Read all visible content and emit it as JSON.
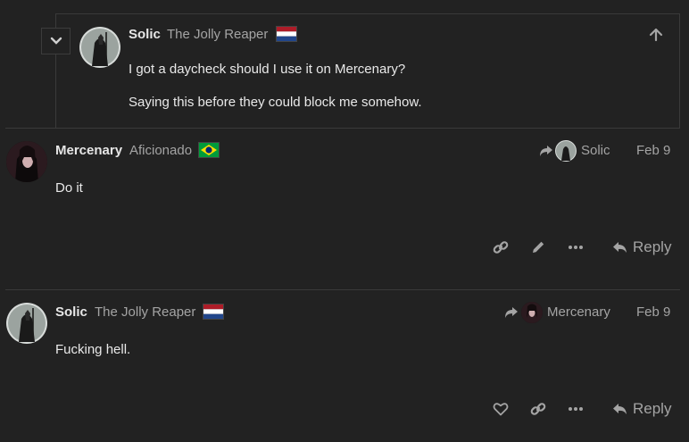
{
  "quoted_post": {
    "username": "Solic",
    "user_title": "The Jolly Reaper",
    "flag": "netherlands-flag",
    "paragraphs": [
      "I got a daycheck should I use it on Mercenary?",
      "Saying this before they could block me somehow."
    ]
  },
  "posts": [
    {
      "username": "Mercenary",
      "user_title": "Aficionado",
      "flag": "brazil-flag",
      "reply_to": "Solic",
      "date": "Feb 9",
      "body": "Do it",
      "reply_label": "Reply"
    },
    {
      "username": "Solic",
      "user_title": "The Jolly Reaper",
      "flag": "netherlands-flag",
      "reply_to": "Mercenary",
      "date": "Feb 9",
      "body": "Fucking hell.",
      "reply_label": "Reply"
    }
  ],
  "colors": {
    "background": "#222222",
    "border": "#3a3a3a",
    "muted": "#a4a4a4",
    "text": "#e9e9e9"
  }
}
